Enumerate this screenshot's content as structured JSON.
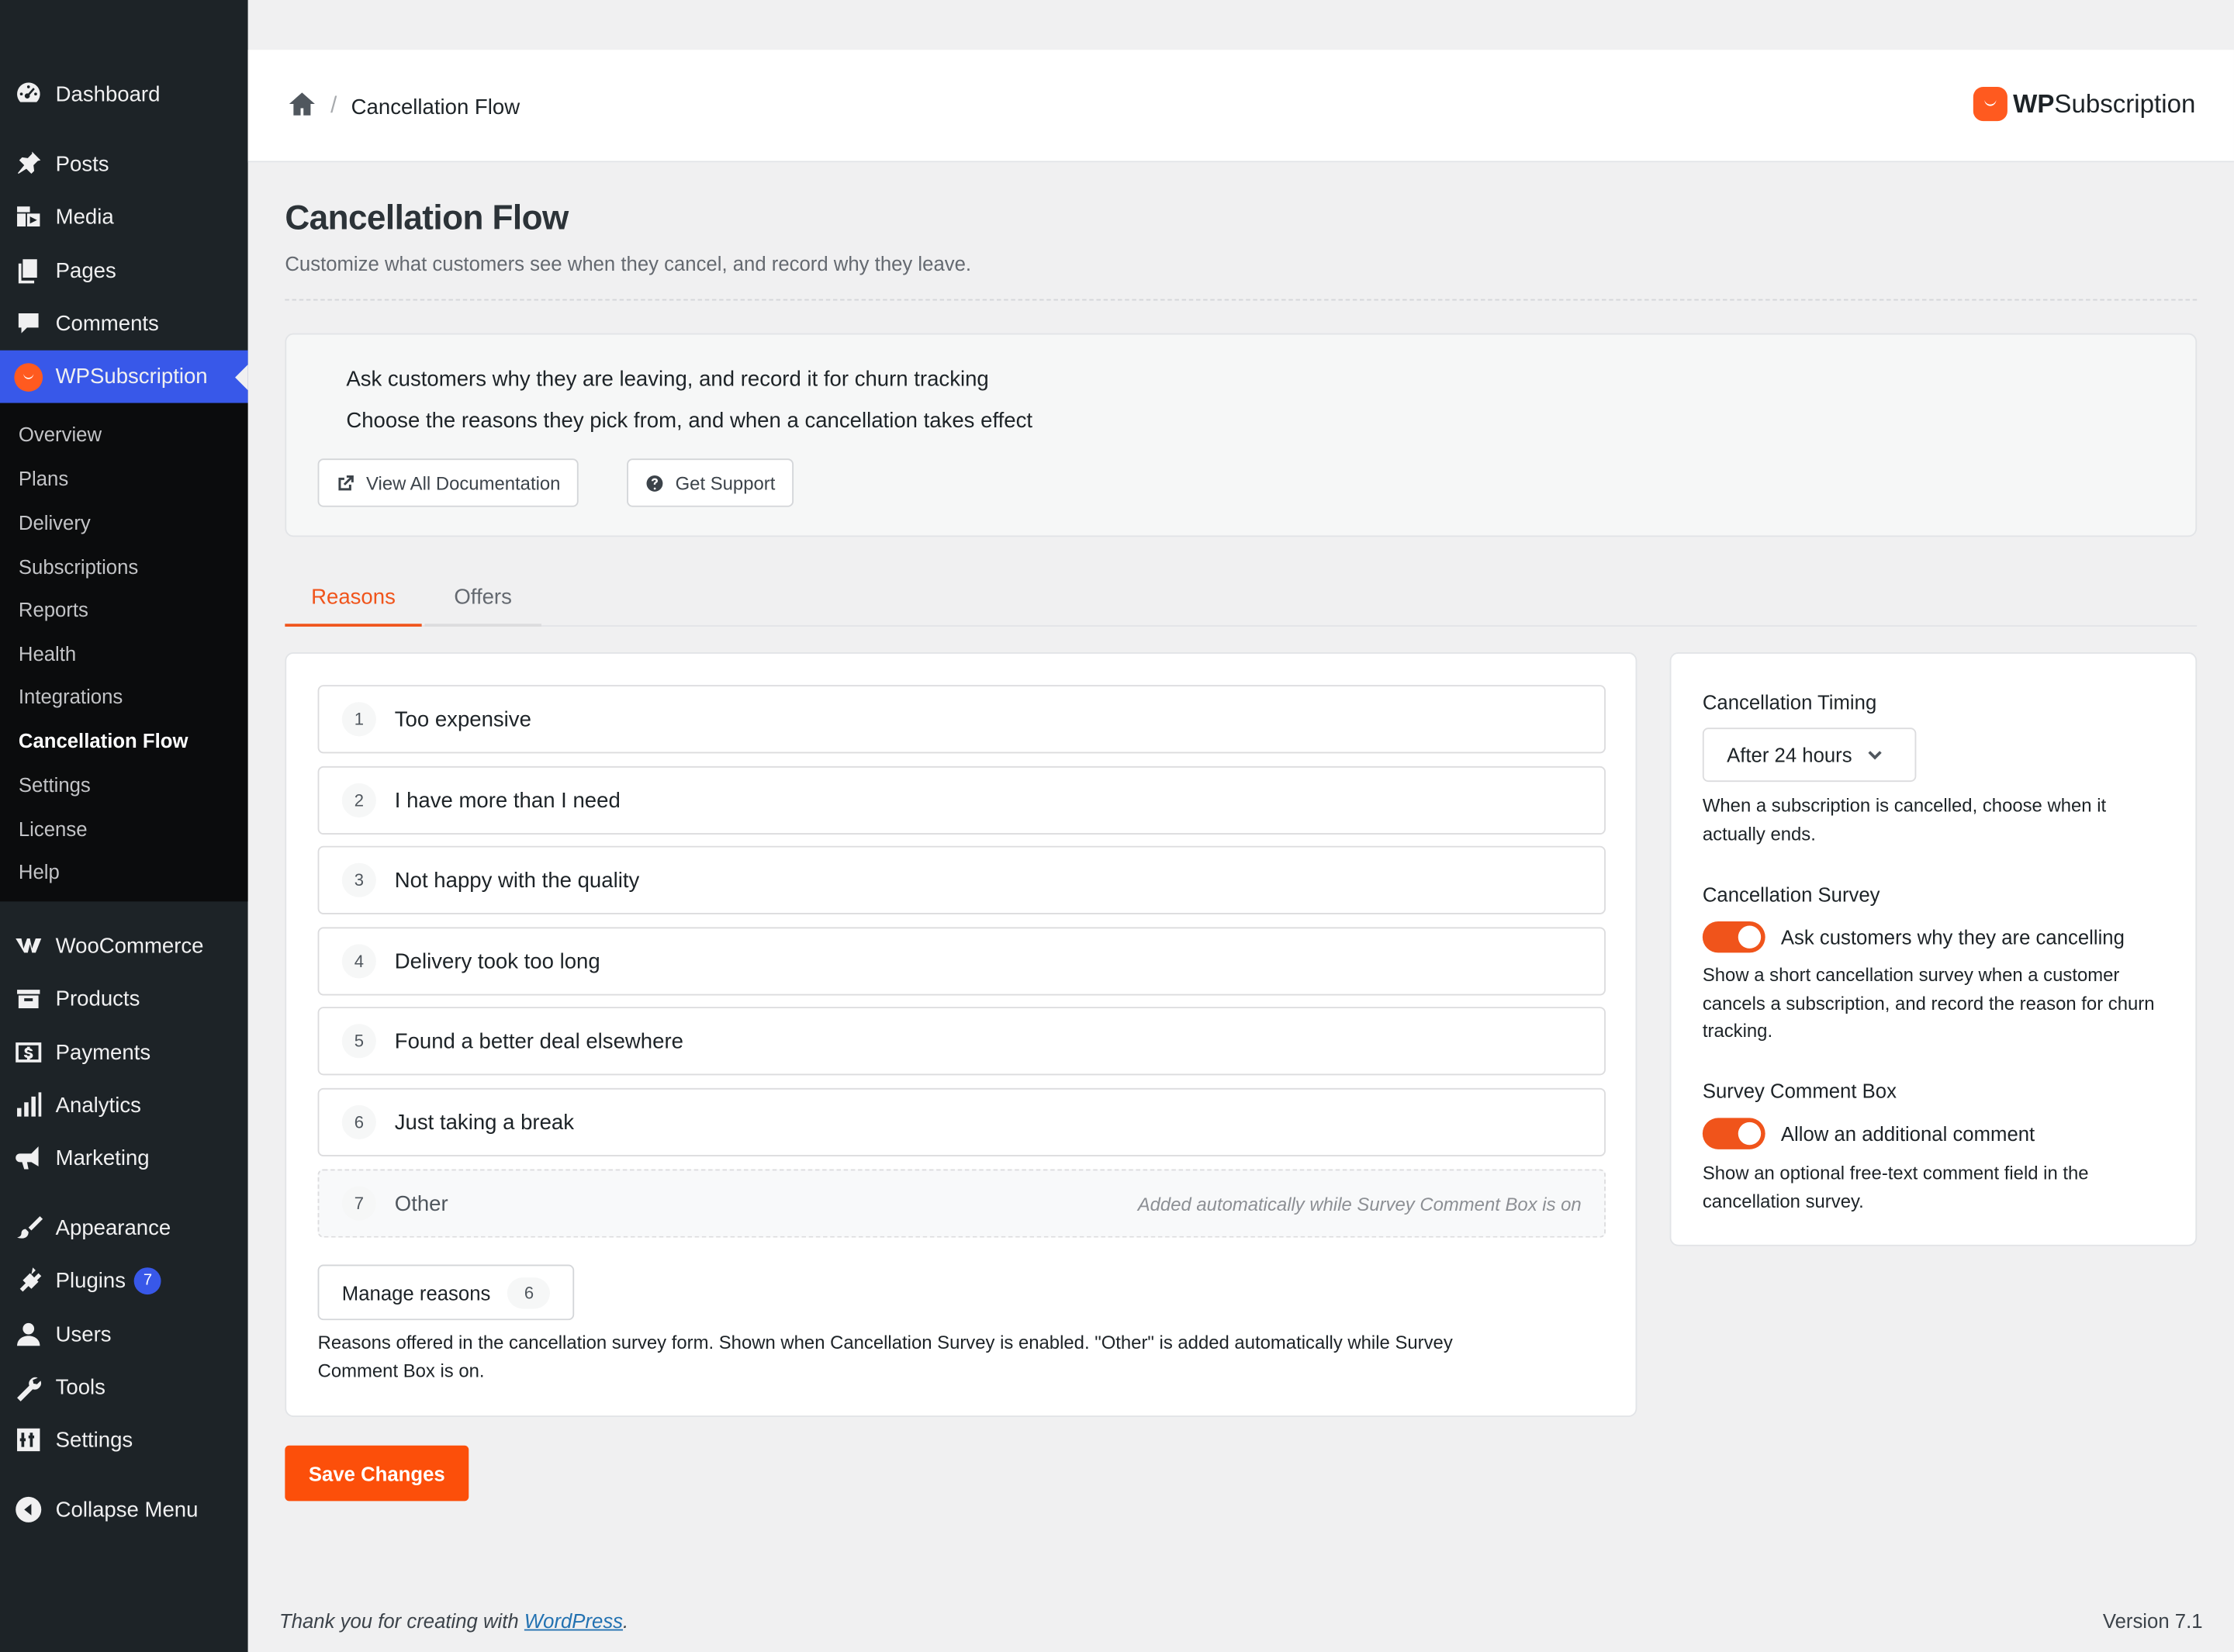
{
  "sidebar": {
    "menu": [
      {
        "label": "Dashboard",
        "icon": "dashboard-icon"
      },
      {
        "label": "Posts",
        "icon": "pin-icon"
      },
      {
        "label": "Media",
        "icon": "media-icon"
      },
      {
        "label": "Pages",
        "icon": "pages-icon"
      },
      {
        "label": "Comments",
        "icon": "comment-icon"
      },
      {
        "label": "WPSubscription",
        "icon": "wpsubscription-icon"
      },
      {
        "label": "WooCommerce",
        "icon": "woocommerce-icon"
      },
      {
        "label": "Products",
        "icon": "archive-icon"
      },
      {
        "label": "Payments",
        "icon": "payments-icon"
      },
      {
        "label": "Analytics",
        "icon": "analytics-icon"
      },
      {
        "label": "Marketing",
        "icon": "megaphone-icon"
      },
      {
        "label": "Appearance",
        "icon": "brush-icon"
      },
      {
        "label": "Plugins",
        "icon": "plugin-icon",
        "badge": "7"
      },
      {
        "label": "Users",
        "icon": "user-icon"
      },
      {
        "label": "Tools",
        "icon": "wrench-icon"
      },
      {
        "label": "Settings",
        "icon": "settings-sliders-icon"
      },
      {
        "label": "Collapse Menu",
        "icon": "collapse-icon"
      }
    ],
    "submenu": [
      "Overview",
      "Plans",
      "Delivery",
      "Subscriptions",
      "Reports",
      "Health",
      "Integrations",
      "Cancellation Flow",
      "Settings",
      "License",
      "Help"
    ]
  },
  "topbar": {
    "breadcrumb": "Cancellation Flow",
    "brand_bold": "WP",
    "brand_rest": "Subscription"
  },
  "page": {
    "title": "Cancellation Flow",
    "subtitle": "Customize what customers see when they cancel, and record why they leave."
  },
  "info": {
    "line1": "Ask customers why they are leaving, and record it for churn tracking",
    "line2": "Choose the reasons they pick from, and when a cancellation takes effect",
    "docs_button": "View All Documentation",
    "support_button": "Get Support"
  },
  "tabs": [
    "Reasons",
    "Offers"
  ],
  "reasons": {
    "items": [
      {
        "num": "1",
        "label": "Too expensive"
      },
      {
        "num": "2",
        "label": "I have more than I need"
      },
      {
        "num": "3",
        "label": "Not happy with the quality"
      },
      {
        "num": "4",
        "label": "Delivery took too long"
      },
      {
        "num": "5",
        "label": "Found a better deal elsewhere"
      },
      {
        "num": "6",
        "label": "Just taking a break"
      }
    ],
    "auto_item": {
      "num": "7",
      "label": "Other",
      "note": "Added automatically while Survey Comment Box is on"
    },
    "manage_label": "Manage reasons",
    "manage_count": "6",
    "help_line1": "Reasons offered in the cancellation survey form. Shown when Cancellation Survey is enabled. \"Other\" is added automatically while Survey",
    "help_line2": "Comment Box is on."
  },
  "settings": {
    "timing_label": "Cancellation Timing",
    "timing_value": "After 24 hours",
    "timing_desc": "When a subscription is cancelled, choose when it actually ends.",
    "survey_label": "Cancellation Survey",
    "survey_toggle_label": "Ask customers why they are cancelling",
    "survey_desc": "Show a short cancellation survey when a customer cancels a subscription, and record the reason for churn tracking.",
    "comment_label": "Survey Comment Box",
    "comment_toggle_label": "Allow an additional comment",
    "comment_desc": "Show an optional free-text comment field in the cancellation survey.",
    "survey_enabled": true,
    "comment_enabled": true
  },
  "save_label": "Save Changes",
  "footer": {
    "thanks_prefix": "Thank you for creating with ",
    "thanks_link": "WordPress",
    "thanks_suffix": ".",
    "version": "Version 7.1"
  },
  "colors": {
    "accent": "#f0541b",
    "admin_blue": "#3858e9",
    "sidebar_bg": "#1d2327"
  }
}
